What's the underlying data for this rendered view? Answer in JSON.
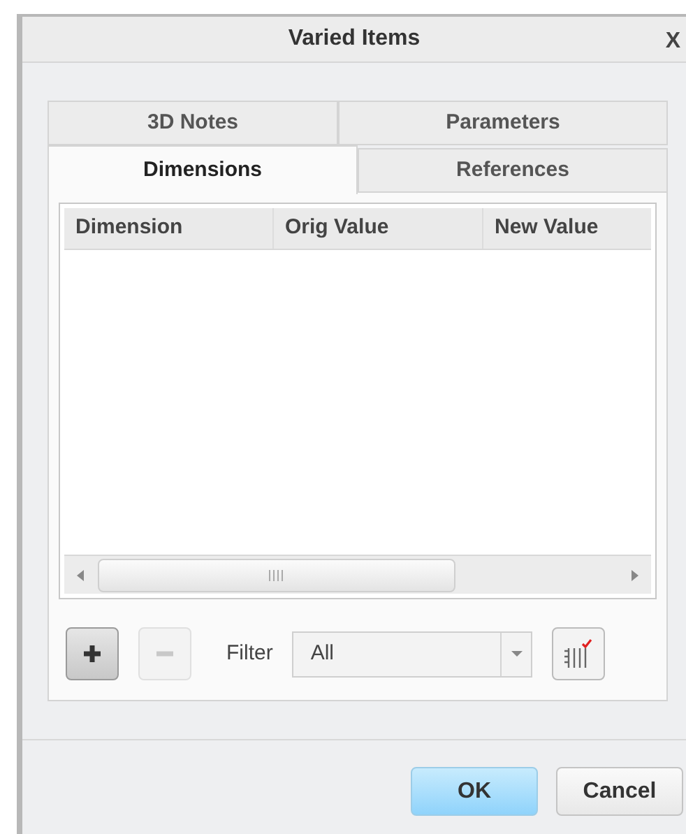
{
  "window": {
    "title": "Varied Items",
    "close": "X"
  },
  "tab_rows": [
    [
      {
        "label": "3D Notes",
        "selected": false
      },
      {
        "label": "Parameters",
        "selected": false
      }
    ],
    [
      {
        "label": "Dimensions",
        "selected": true
      },
      {
        "label": "References",
        "selected": false
      }
    ]
  ],
  "table": {
    "columns": [
      "Dimension",
      "Orig Value",
      "New Value"
    ]
  },
  "toolbar": {
    "add_disabled": false,
    "remove_disabled": true,
    "filter_label": "Filter",
    "filter_value": "All"
  },
  "buttons": [
    {
      "label": "OK",
      "kind": "primary"
    },
    {
      "label": "Cancel",
      "kind": "normal"
    }
  ]
}
